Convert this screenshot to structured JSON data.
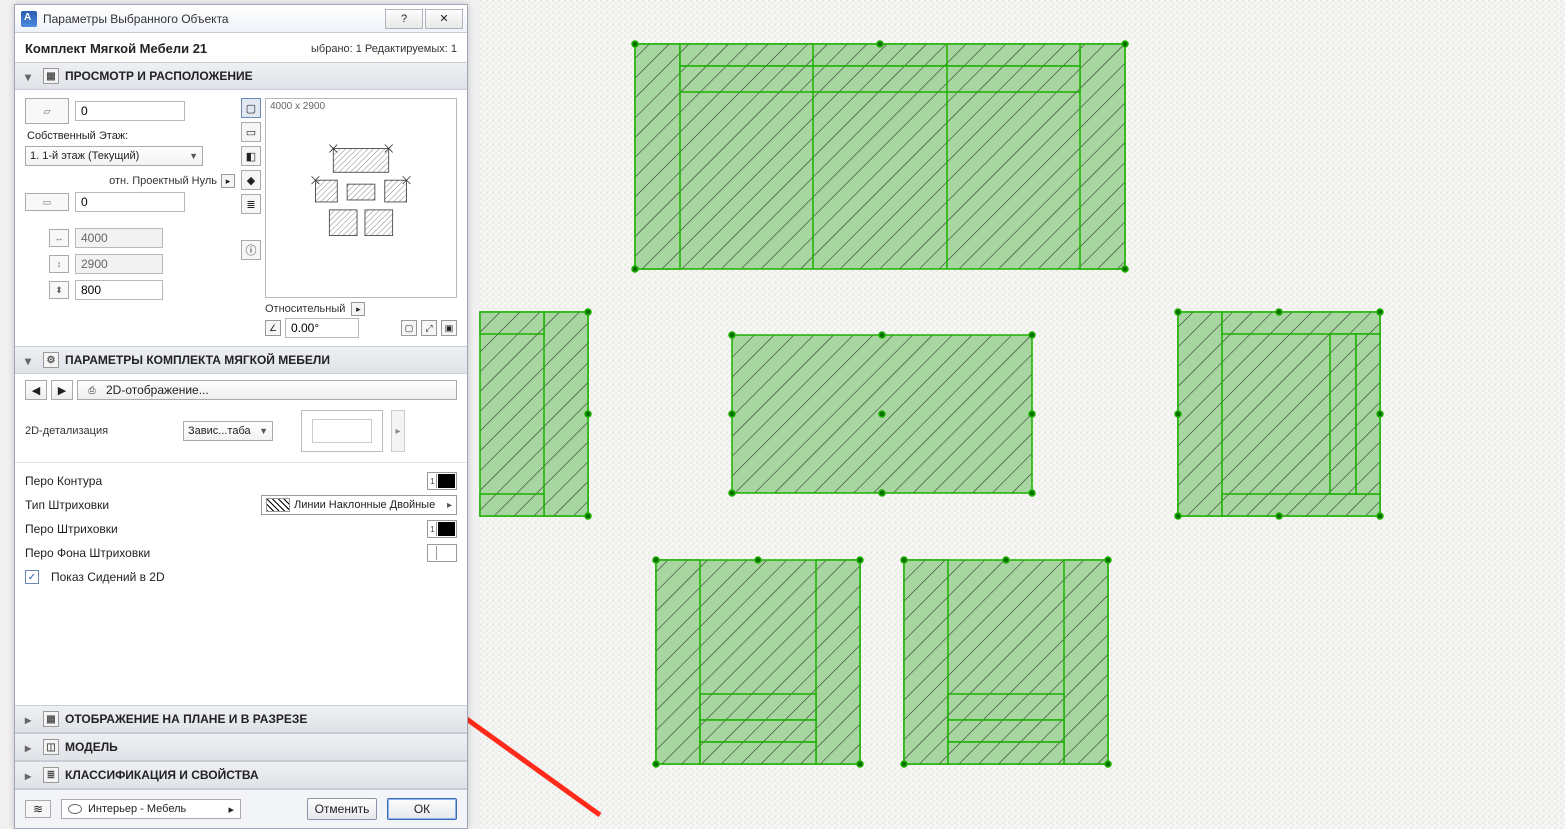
{
  "dialog": {
    "title": "Параметры Выбранного Объекта",
    "object_name": "Комплект Мягкой Мебели 21",
    "selection_info": "ыбрано: 1 Редактируемых: 1"
  },
  "sections": {
    "preview": "ПРОСМОТР И РАСПОЛОЖЕНИЕ",
    "params": "ПАРАМЕТРЫ КОМПЛЕКТА МЯГКОЙ МЕБЕЛИ",
    "plan": "ОТОБРАЖЕНИЕ НА ПЛАНЕ И В РАЗРЕЗЕ",
    "model": "МОДЕЛЬ",
    "class": "КЛАССИФИКАЦИЯ И СВОЙСТВА"
  },
  "placement": {
    "elev_top": "0",
    "own_floor_label": "Собственный Этаж:",
    "own_floor_value": "1. 1-й этаж (Текущий)",
    "rel_project_zero": "отн. Проектный Нуль",
    "elev_bottom": "0",
    "dim_x": "4000",
    "dim_y": "2900",
    "dim_z": "800"
  },
  "preview": {
    "dims_text": "4000 x 2900",
    "relative_label": "Относительный",
    "angle": "0.00°"
  },
  "nav": {
    "page_label": "2D-отображение..."
  },
  "detail": {
    "label": "2D-детализация",
    "select_value": "Завис...таба"
  },
  "params": {
    "p1": "Перо Контура",
    "p2": "Тип Штриховки",
    "p2_val": "Линии Наклонные Двойные",
    "p3": "Перо Штриховки",
    "p4": "Перо Фона Штриховки",
    "p5": "Показ Сидений в 2D"
  },
  "footer": {
    "layer": "Интерьер - Мебель",
    "cancel": "Отменить",
    "ok": "ОК"
  }
}
